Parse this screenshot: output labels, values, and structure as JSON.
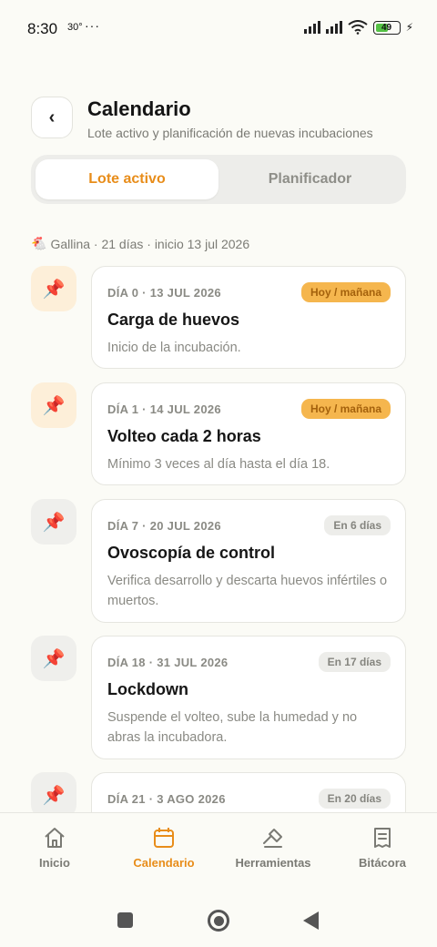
{
  "status_bar": {
    "time": "8:30",
    "temperature": "30°",
    "overflow": "···",
    "battery": "49"
  },
  "header": {
    "back_label": "‹",
    "title": "Calendario",
    "subtitle": "Lote activo y planificación de nuevas incubaciones"
  },
  "tabs": [
    {
      "label": "Lote activo",
      "active": true
    },
    {
      "label": "Planificador",
      "active": false
    }
  ],
  "batch_info": {
    "icon": "🐔",
    "text": "Gallina · 21 días · inicio 13 jul 2026"
  },
  "events": [
    {
      "day": "DÍA 0 · 13 JUL 2026",
      "badge": "Hoy / mañana",
      "status": "today",
      "title": "Carga de huevos",
      "description": "Inicio de la incubación."
    },
    {
      "day": "DÍA 1 · 14 JUL 2026",
      "badge": "Hoy / mañana",
      "status": "today",
      "title": "Volteo cada 2 horas",
      "description": "Mínimo 3 veces al día hasta el día 18."
    },
    {
      "day": "DÍA 7 · 20 JUL 2026",
      "badge": "En 6 días",
      "status": "future",
      "title": "Ovoscopía de control",
      "description": "Verifica desarrollo y descarta huevos infértiles o muertos."
    },
    {
      "day": "DÍA 18 · 31 JUL 2026",
      "badge": "En 17 días",
      "status": "future",
      "title": "Lockdown",
      "description": "Suspende el volteo, sube la humedad y no abras la incubadora."
    },
    {
      "day": "DÍA 21 · 3 AGO 2026",
      "badge": "En 20 días",
      "status": "future",
      "title": "",
      "description": ""
    }
  ],
  "pin_icon": "📌",
  "bottom_nav": [
    {
      "label": "Inicio",
      "icon": "home-icon",
      "active": false
    },
    {
      "label": "Calendario",
      "icon": "calendar-icon",
      "active": true
    },
    {
      "label": "Herramientas",
      "icon": "tools-icon",
      "active": false
    },
    {
      "label": "Bitácora",
      "icon": "log-icon",
      "active": false
    }
  ],
  "colors": {
    "accent": "#e88d1a",
    "badge_today_bg": "#f5b64e",
    "pin_today_bg": "#fdefd9",
    "background": "#fbfbf6"
  }
}
